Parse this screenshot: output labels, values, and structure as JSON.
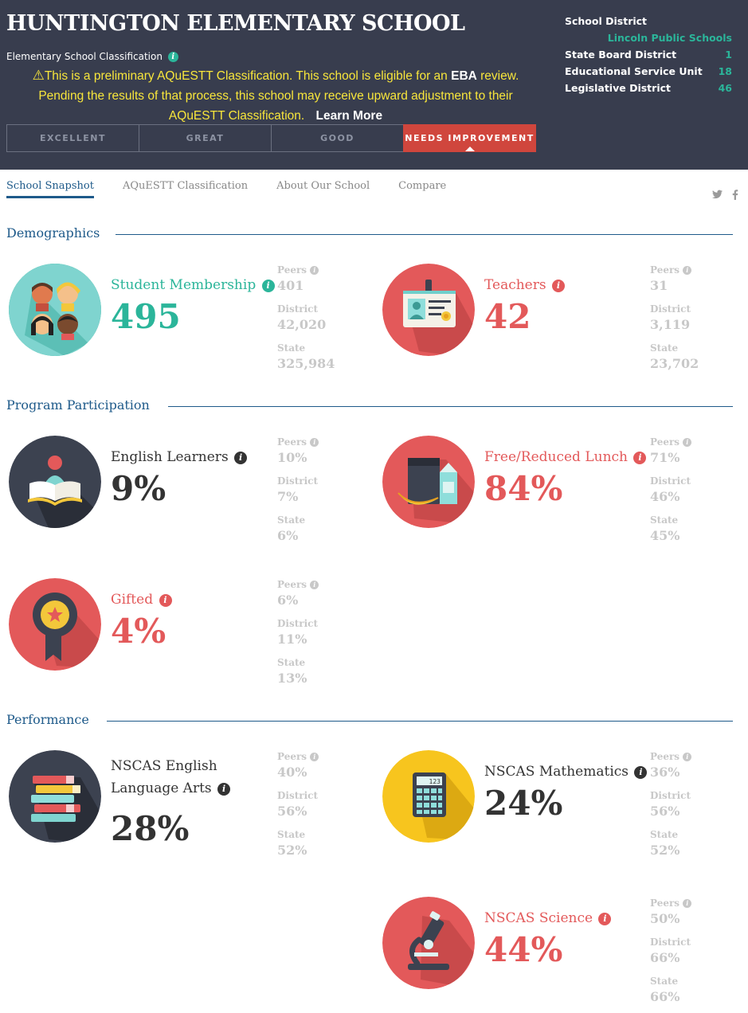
{
  "header": {
    "school_name": "HUNTINGTON ELEMENTARY SCHOOL",
    "classification_label": "Elementary School Classification",
    "notice_part1": "This is a preliminary AQuESTT Classification. This school is eligible for an ",
    "notice_eba": "EBA",
    "notice_part2": " review. Pending the results of that process, this school may receive upward adjustment to their AQuESTT Classification.",
    "learn_more": "Learn More",
    "classification_levels": [
      "EXCELLENT",
      "GREAT",
      "GOOD",
      "NEEDS IMPROVEMENT"
    ],
    "active_level": "NEEDS IMPROVEMENT"
  },
  "district": {
    "school_district_label": "School District",
    "school_district_value": "Lincoln Public Schools",
    "rows": [
      {
        "label": "State Board District",
        "value": "1"
      },
      {
        "label": "Educational Service Unit",
        "value": "18"
      },
      {
        "label": "Legislative District",
        "value": "46"
      }
    ]
  },
  "nav": {
    "tabs": [
      "School Snapshot",
      "AQuESTT Classification",
      "About Our School",
      "Compare"
    ],
    "active_tab": "School Snapshot",
    "social_icons": [
      "twitter-icon",
      "facebook-icon"
    ]
  },
  "comparison_labels": {
    "peers": "Peers",
    "district": "District",
    "state": "State"
  },
  "sections": {
    "demographics": "Demographics",
    "program_participation": "Program Participation",
    "performance": "Performance"
  },
  "metrics": {
    "student_membership": {
      "label": "Student Membership",
      "value": "495",
      "peers": "401",
      "district": "42,020",
      "state": "325,984",
      "icon": "students-icon"
    },
    "teachers": {
      "label": "Teachers",
      "value": "42",
      "peers": "31",
      "district": "3,119",
      "state": "23,702",
      "icon": "id-badge-icon"
    },
    "english_learners": {
      "label": "English Learners",
      "value": "9%",
      "peers": "10%",
      "district": "7%",
      "state": "6%",
      "icon": "reader-icon"
    },
    "free_reduced_lunch": {
      "label": "Free/Reduced Lunch",
      "value": "84%",
      "peers": "71%",
      "district": "46%",
      "state": "45%",
      "icon": "lunch-icon"
    },
    "gifted": {
      "label": "Gifted",
      "value": "4%",
      "peers": "6%",
      "district": "11%",
      "state": "13%",
      "icon": "award-ribbon-icon"
    },
    "nscas_ela": {
      "label": "NSCAS English Language Arts",
      "value": "28%",
      "peers": "40%",
      "district": "56%",
      "state": "52%",
      "icon": "books-icon"
    },
    "nscas_math": {
      "label": "NSCAS Mathematics",
      "value": "24%",
      "peers": "36%",
      "district": "56%",
      "state": "52%",
      "icon": "calculator-icon",
      "calculator_display": "123"
    },
    "nscas_science": {
      "label": "NSCAS Science",
      "value": "44%",
      "peers": "50%",
      "district": "66%",
      "state": "66%",
      "icon": "microscope-icon"
    }
  },
  "colors": {
    "header_bg": "#383d4e",
    "teal": "#2bb59a",
    "red": "#e3595a",
    "yellow": "#f8e63b",
    "nav_blue": "#1e5a8a",
    "needs_improvement": "#d0463d",
    "dark_circle": "#3c4250",
    "yellow_circle": "#f7c51e"
  }
}
